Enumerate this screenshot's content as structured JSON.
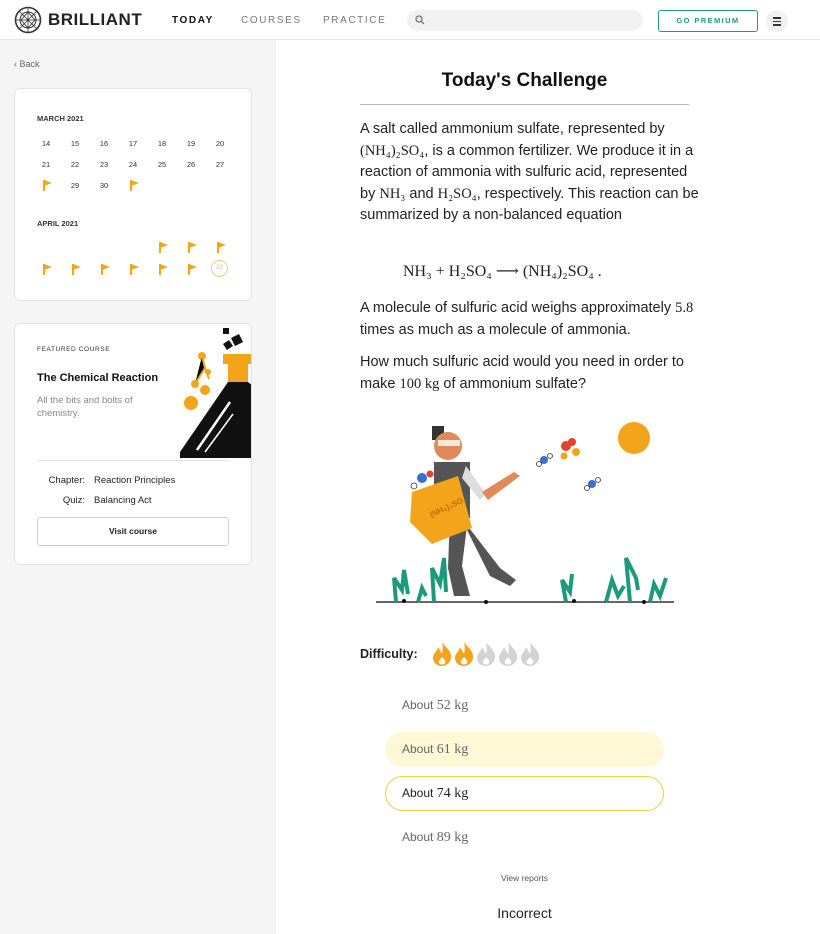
{
  "nav": {
    "brand": "BRILLIANT",
    "tabs": [
      "TODAY",
      "COURSES",
      "PRACTICE"
    ],
    "active_tab": "TODAY",
    "search_placeholder": "",
    "premium_label": "GO PREMIUM",
    "icons": {
      "logo": "brilliant-logo-icon",
      "search": "search-icon",
      "menu": "hamburger-menu-icon"
    }
  },
  "sidebar": {
    "back_label": "Back",
    "calendar": {
      "march": {
        "label": "MARCH 2021",
        "row1": [
          "14",
          "15",
          "16",
          "17",
          "18",
          "19",
          "20"
        ],
        "row2": [
          "21",
          "22",
          "23",
          "24",
          "25",
          "26",
          "27"
        ],
        "row3_days": [
          "29",
          "30"
        ]
      },
      "april": {
        "label": "APRIL 2021",
        "today_day": "10"
      },
      "accent_color": "#f2a51a"
    },
    "featured": {
      "label": "FEATURED COURSE",
      "title": "The Chemical Reaction",
      "description": "All the bits and bolts of chemistry.",
      "chapter_label": "Chapter:",
      "chapter_value": "Reaction Principles",
      "quiz_label": "Quiz:",
      "quiz_value": "Balancing Act",
      "visit_label": "Visit course"
    }
  },
  "main": {
    "title": "Today's Challenge",
    "p1_a": "A salt called ammonium sulfate, represented by",
    "p1_formula1": "(NH₄)₂SO₄",
    "p1_b": ", is a common fertilizer. We produce it in a reaction of ammonia with sulfuric acid, represented by",
    "p1_formula2": "NH₃",
    "p1_and": "and",
    "p1_formula3": "H₂SO₄",
    "p1_c": ", respectively. This reaction can be summarized by a non-balanced equation",
    "equation": "NH₃ + H₂SO₄ ⟶ (NH₄)₂SO₄ .",
    "p2_value": "5.8",
    "p2_a": "A molecule of sulfuric acid weighs approximately",
    "p2_b": "times as much as a molecule of ammonia.",
    "p3_a": "How much sulfuric acid would you need in order to make",
    "p3_amount": "100 kg",
    "p3_b": "of ammonium sulfate?",
    "illustration_bag_text": "(NH₄)₂SO₄",
    "difficulty_label": "Difficulty:",
    "difficulty_level": 2,
    "difficulty_max": 5,
    "choices": [
      {
        "prefix": "About",
        "value": "52 kg",
        "state": "default"
      },
      {
        "prefix": "About",
        "value": "61 kg",
        "state": "hover"
      },
      {
        "prefix": "About",
        "value": "74 kg",
        "state": "selected"
      },
      {
        "prefix": "About",
        "value": "89 kg",
        "state": "default"
      }
    ],
    "view_reports": "View reports",
    "result": "Incorrect"
  }
}
